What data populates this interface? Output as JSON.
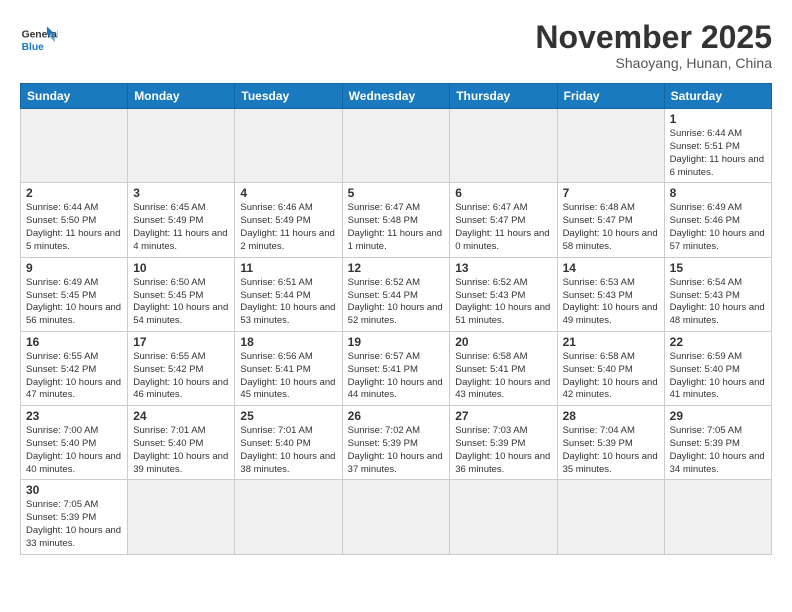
{
  "header": {
    "logo_general": "General",
    "logo_blue": "Blue",
    "month_title": "November 2025",
    "location": "Shaoyang, Hunan, China"
  },
  "days_of_week": [
    "Sunday",
    "Monday",
    "Tuesday",
    "Wednesday",
    "Thursday",
    "Friday",
    "Saturday"
  ],
  "weeks": [
    [
      {
        "day": "",
        "info": ""
      },
      {
        "day": "",
        "info": ""
      },
      {
        "day": "",
        "info": ""
      },
      {
        "day": "",
        "info": ""
      },
      {
        "day": "",
        "info": ""
      },
      {
        "day": "",
        "info": ""
      },
      {
        "day": "1",
        "info": "Sunrise: 6:44 AM\nSunset: 5:51 PM\nDaylight: 11 hours and 6 minutes."
      }
    ],
    [
      {
        "day": "2",
        "info": "Sunrise: 6:44 AM\nSunset: 5:50 PM\nDaylight: 11 hours and 5 minutes."
      },
      {
        "day": "3",
        "info": "Sunrise: 6:45 AM\nSunset: 5:49 PM\nDaylight: 11 hours and 4 minutes."
      },
      {
        "day": "4",
        "info": "Sunrise: 6:46 AM\nSunset: 5:49 PM\nDaylight: 11 hours and 2 minutes."
      },
      {
        "day": "5",
        "info": "Sunrise: 6:47 AM\nSunset: 5:48 PM\nDaylight: 11 hours and 1 minute."
      },
      {
        "day": "6",
        "info": "Sunrise: 6:47 AM\nSunset: 5:47 PM\nDaylight: 11 hours and 0 minutes."
      },
      {
        "day": "7",
        "info": "Sunrise: 6:48 AM\nSunset: 5:47 PM\nDaylight: 10 hours and 58 minutes."
      },
      {
        "day": "8",
        "info": "Sunrise: 6:49 AM\nSunset: 5:46 PM\nDaylight: 10 hours and 57 minutes."
      }
    ],
    [
      {
        "day": "9",
        "info": "Sunrise: 6:49 AM\nSunset: 5:45 PM\nDaylight: 10 hours and 56 minutes."
      },
      {
        "day": "10",
        "info": "Sunrise: 6:50 AM\nSunset: 5:45 PM\nDaylight: 10 hours and 54 minutes."
      },
      {
        "day": "11",
        "info": "Sunrise: 6:51 AM\nSunset: 5:44 PM\nDaylight: 10 hours and 53 minutes."
      },
      {
        "day": "12",
        "info": "Sunrise: 6:52 AM\nSunset: 5:44 PM\nDaylight: 10 hours and 52 minutes."
      },
      {
        "day": "13",
        "info": "Sunrise: 6:52 AM\nSunset: 5:43 PM\nDaylight: 10 hours and 51 minutes."
      },
      {
        "day": "14",
        "info": "Sunrise: 6:53 AM\nSunset: 5:43 PM\nDaylight: 10 hours and 49 minutes."
      },
      {
        "day": "15",
        "info": "Sunrise: 6:54 AM\nSunset: 5:43 PM\nDaylight: 10 hours and 48 minutes."
      }
    ],
    [
      {
        "day": "16",
        "info": "Sunrise: 6:55 AM\nSunset: 5:42 PM\nDaylight: 10 hours and 47 minutes."
      },
      {
        "day": "17",
        "info": "Sunrise: 6:55 AM\nSunset: 5:42 PM\nDaylight: 10 hours and 46 minutes."
      },
      {
        "day": "18",
        "info": "Sunrise: 6:56 AM\nSunset: 5:41 PM\nDaylight: 10 hours and 45 minutes."
      },
      {
        "day": "19",
        "info": "Sunrise: 6:57 AM\nSunset: 5:41 PM\nDaylight: 10 hours and 44 minutes."
      },
      {
        "day": "20",
        "info": "Sunrise: 6:58 AM\nSunset: 5:41 PM\nDaylight: 10 hours and 43 minutes."
      },
      {
        "day": "21",
        "info": "Sunrise: 6:58 AM\nSunset: 5:40 PM\nDaylight: 10 hours and 42 minutes."
      },
      {
        "day": "22",
        "info": "Sunrise: 6:59 AM\nSunset: 5:40 PM\nDaylight: 10 hours and 41 minutes."
      }
    ],
    [
      {
        "day": "23",
        "info": "Sunrise: 7:00 AM\nSunset: 5:40 PM\nDaylight: 10 hours and 40 minutes."
      },
      {
        "day": "24",
        "info": "Sunrise: 7:01 AM\nSunset: 5:40 PM\nDaylight: 10 hours and 39 minutes."
      },
      {
        "day": "25",
        "info": "Sunrise: 7:01 AM\nSunset: 5:40 PM\nDaylight: 10 hours and 38 minutes."
      },
      {
        "day": "26",
        "info": "Sunrise: 7:02 AM\nSunset: 5:39 PM\nDaylight: 10 hours and 37 minutes."
      },
      {
        "day": "27",
        "info": "Sunrise: 7:03 AM\nSunset: 5:39 PM\nDaylight: 10 hours and 36 minutes."
      },
      {
        "day": "28",
        "info": "Sunrise: 7:04 AM\nSunset: 5:39 PM\nDaylight: 10 hours and 35 minutes."
      },
      {
        "day": "29",
        "info": "Sunrise: 7:05 AM\nSunset: 5:39 PM\nDaylight: 10 hours and 34 minutes."
      }
    ],
    [
      {
        "day": "30",
        "info": "Sunrise: 7:05 AM\nSunset: 5:39 PM\nDaylight: 10 hours and 33 minutes."
      },
      {
        "day": "",
        "info": ""
      },
      {
        "day": "",
        "info": ""
      },
      {
        "day": "",
        "info": ""
      },
      {
        "day": "",
        "info": ""
      },
      {
        "day": "",
        "info": ""
      },
      {
        "day": "",
        "info": ""
      }
    ]
  ]
}
